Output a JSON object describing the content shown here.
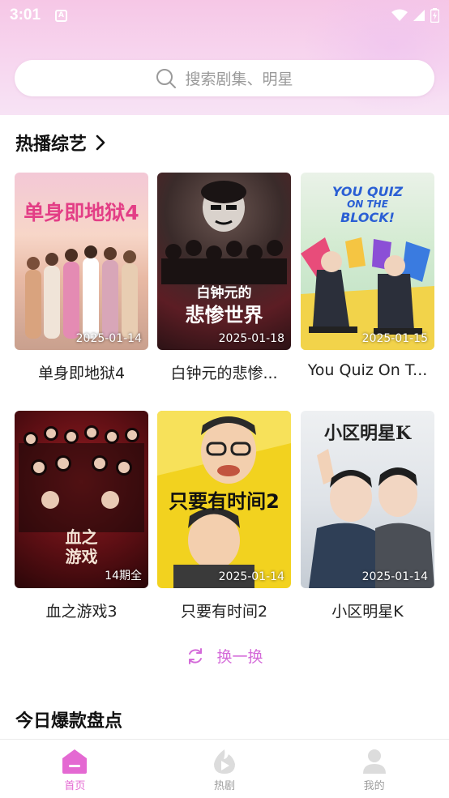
{
  "status_bar": {
    "time": "3:01",
    "notification_icon": "A"
  },
  "search": {
    "placeholder": "搜索剧集、明星"
  },
  "hot_variety": {
    "title": "热播综艺",
    "items": [
      {
        "title": "单身即地狱4",
        "badge": "2025-01-14",
        "poster_text": "单身即地狱4"
      },
      {
        "title": "白钟元的悲惨...",
        "badge": "2025-01-18",
        "poster_text_line1": "白钟元的",
        "poster_text_line2": "悲惨世界"
      },
      {
        "title": "You Quiz On T...",
        "badge": "2025-01-15",
        "poster_text_line1": "YOU QUIZ",
        "poster_text_line2": "ON THE",
        "poster_text_line3": "BLOCK!"
      },
      {
        "title": "血之游戏3",
        "badge": "14期全",
        "poster_text_line1": "血之",
        "poster_text_line2": "游戏"
      },
      {
        "title": "只要有时间2",
        "badge": "2025-01-14",
        "poster_text": "只要有时间2"
      },
      {
        "title": "小区明星K",
        "badge": "2025-01-14",
        "poster_text": "小区明星K"
      }
    ],
    "refresh_label": "换一换"
  },
  "today_hits": {
    "title": "今日爆款盘点"
  },
  "bottom_nav": {
    "items": [
      {
        "label": "首页",
        "icon": "home-icon",
        "active": true
      },
      {
        "label": "热剧",
        "icon": "play-icon",
        "active": false
      },
      {
        "label": "我的",
        "icon": "user-icon",
        "active": false
      }
    ]
  },
  "colors": {
    "accent": "#e469d2",
    "header_gradient_top": "#f6c7e6",
    "inactive_nav": "#9c9c9c"
  }
}
